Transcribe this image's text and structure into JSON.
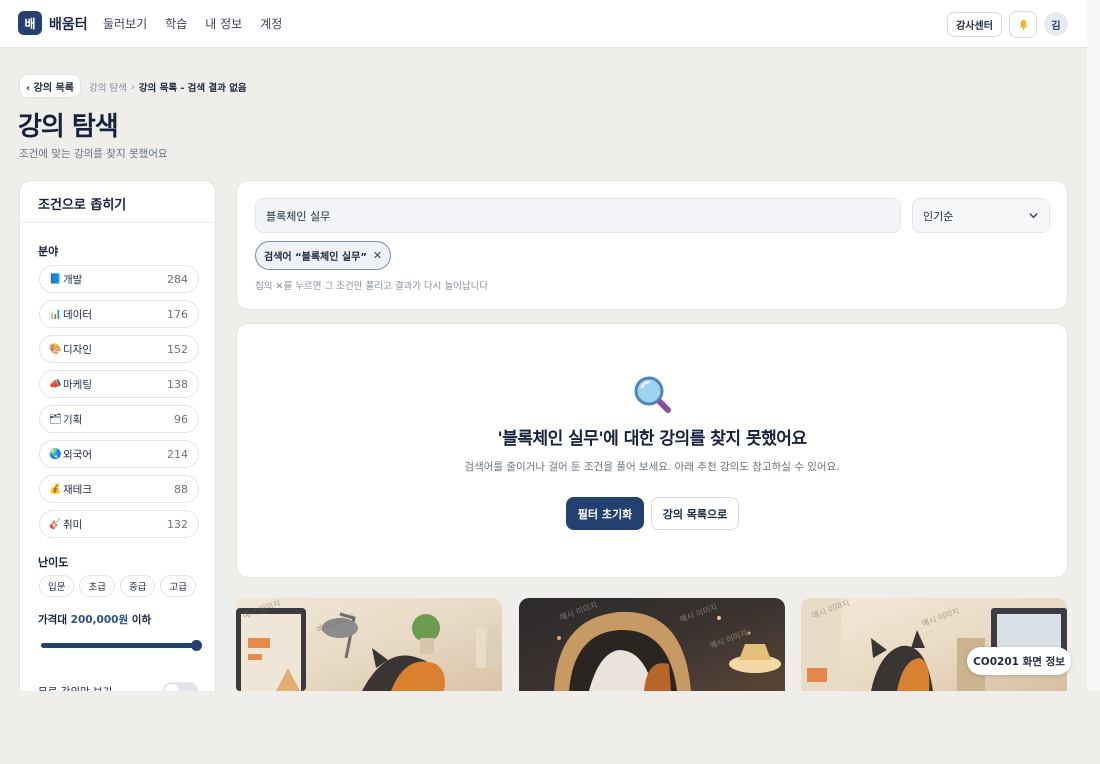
{
  "header": {
    "logo_mark": "배",
    "logo_text": "배움터",
    "nav": [
      "둘러보기",
      "학습",
      "내 정보",
      "계정"
    ],
    "instructor_label": "강사센터",
    "bell_icon": "bell-icon",
    "avatar_label": "김"
  },
  "breadcrumb": {
    "back_label": "‹ 강의 목록",
    "items": [
      "강의 탐색",
      "강의 목록 - 검색 결과 없음"
    ],
    "separator": "›"
  },
  "page": {
    "title": "강의 탐색",
    "subtitle": "조건에 맞는 강의를 찾지 못했어요"
  },
  "sidebar": {
    "title": "조건으로 좁히기",
    "category_label": "분야",
    "categories": [
      {
        "icon": "📘",
        "label": "개발",
        "count": "284"
      },
      {
        "icon": "📊",
        "label": "데이터",
        "count": "176"
      },
      {
        "icon": "🎨",
        "label": "디자인",
        "count": "152"
      },
      {
        "icon": "📣",
        "label": "마케팅",
        "count": "138"
      },
      {
        "icon": "🗂",
        "label": "기획",
        "count": "96"
      },
      {
        "icon": "🌏",
        "label": "외국어",
        "count": "214"
      },
      {
        "icon": "💰",
        "label": "재테크",
        "count": "88"
      },
      {
        "icon": "🎸",
        "label": "취미",
        "count": "132"
      }
    ],
    "level_label": "난이도",
    "levels": [
      "입문",
      "초급",
      "중급",
      "고급"
    ],
    "price_prefix": "가격대 ",
    "price_value": "200,000원",
    "price_suffix": " 이하",
    "price_slider_fraction": 1.0,
    "free_only_label": "무료 강의만 보기",
    "free_only_on": false
  },
  "search": {
    "query": "블록체인 실무",
    "sort_label": "인기순",
    "active_filter": "검색어 “블록체인 실무”",
    "filter_remove": "✕",
    "hint": "칩의 ✕를 누르면 그 조건만 풀리고 결과가 다시 늘어납니다"
  },
  "empty_state": {
    "title": "'블록체인 실무'에 대한 강의를 찾지 못했어요",
    "description": "검색어를 줄이거나 걸어 둔 조건을 풀어 보세요. 아래 추천 강의도 참고하실 수 있어요.",
    "reset_label": "필터 초기화",
    "list_label": "강의 목록으로"
  },
  "recommendations": {
    "watermark": "예시 이미지"
  },
  "screen_badge": "CO0201 화면 정보",
  "colors": {
    "accent": "#24406f",
    "background": "#efeeea",
    "card": "#ffffff"
  }
}
